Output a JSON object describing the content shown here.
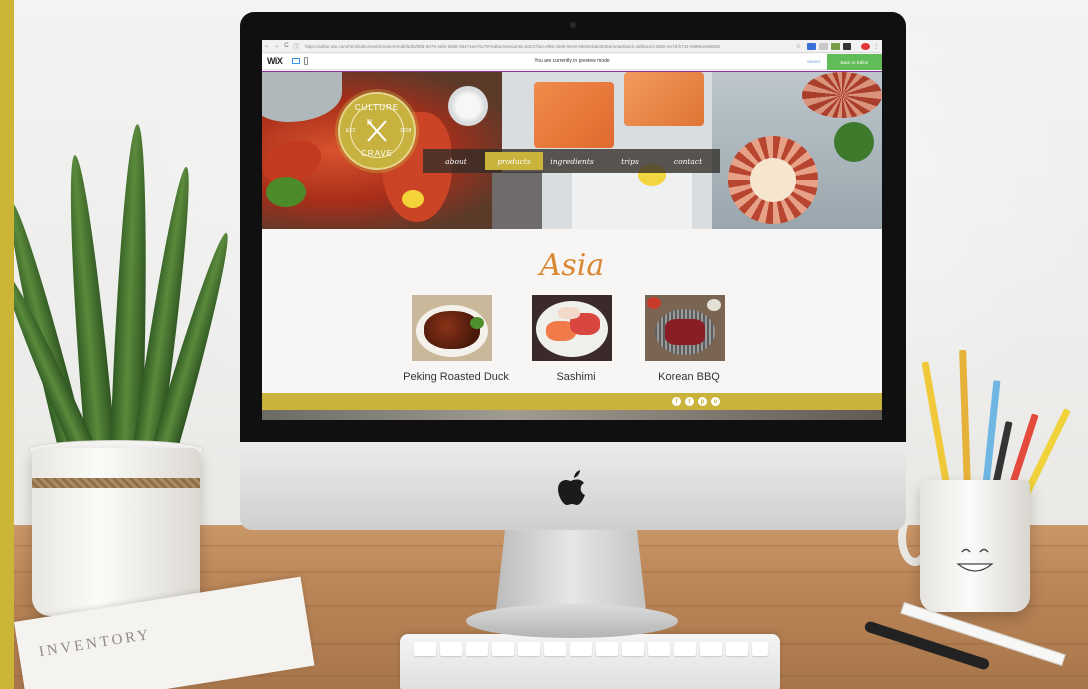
{
  "browser": {
    "url": "https://editor.wix.com/html/editor/web/renderer/edit/5d52f8fd-8079-4afe-98d5-35474ee75c79?editorSessionId=84237fa4-ef86-42eb-9ec8-588364a8400b&metaSiteId=4df0ac24-3d80-4e7d-b732-0098e2a985d0",
    "nav_back": "←",
    "nav_forward": "→",
    "nav_reload": "C"
  },
  "wix": {
    "logo": "WiX",
    "preview_message": "You are currently in preview mode",
    "saved_label": "Saved",
    "back_to_editor_label": "Back to Editor"
  },
  "site": {
    "logo": {
      "top_text": "CULTURE",
      "bottom_text": "CRAVE",
      "left_text": "EST",
      "right_text": "2018"
    },
    "nav": [
      {
        "label": "about",
        "active": false
      },
      {
        "label": "products",
        "active": true
      },
      {
        "label": "ingredients",
        "active": false
      },
      {
        "label": "trips",
        "active": false
      },
      {
        "label": "contact",
        "active": false
      }
    ],
    "region_title": "Asia",
    "dishes": [
      {
        "name": "Peking Roasted Duck"
      },
      {
        "name": "Sashimi"
      },
      {
        "name": "Korean BBQ"
      }
    ],
    "social": [
      {
        "icon": "facebook-icon",
        "glyph": "f"
      },
      {
        "icon": "twitter-icon",
        "glyph": "t"
      },
      {
        "icon": "pinterest-icon",
        "glyph": "p"
      },
      {
        "icon": "instagram-icon",
        "glyph": "o"
      }
    ]
  },
  "desk": {
    "notebook_text": "INVENTORY"
  },
  "colors": {
    "brand_gold": "#c9b33b",
    "title_orange": "#d98733",
    "wix_green": "#60bc57",
    "frame": "#cbb436"
  }
}
